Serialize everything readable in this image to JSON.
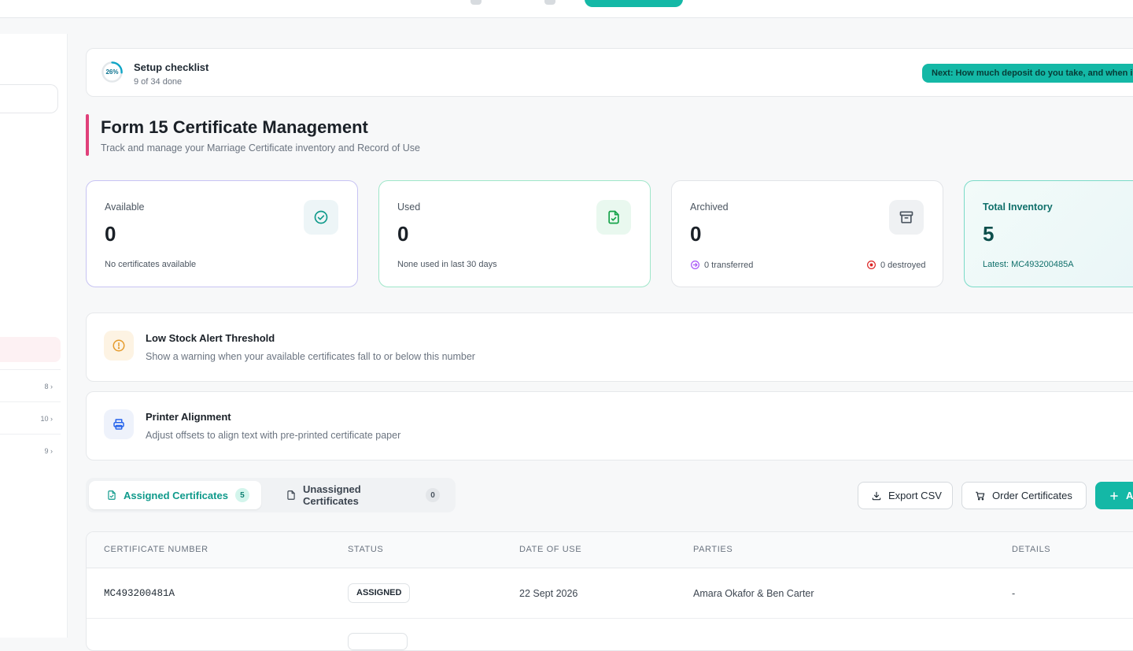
{
  "checklist": {
    "percent_label": "26%",
    "progress": 0.26,
    "title": "Setup checklist",
    "subtitle": "9 of 34 done",
    "next_label": "Next: How much deposit do you take, and when is"
  },
  "header": {
    "title": "Form 15 Certificate Management",
    "subtitle": "Track and manage your Marriage Certificate inventory and Record of Use"
  },
  "sidebar": {
    "counts": [
      "8 ›",
      "10 ›",
      "9 ›"
    ]
  },
  "stats": {
    "available": {
      "label": "Available",
      "value": "0",
      "note": "No certificates available"
    },
    "used": {
      "label": "Used",
      "value": "0",
      "note": "None used in last 30 days"
    },
    "archived": {
      "label": "Archived",
      "value": "0",
      "transferred": "0 transferred",
      "destroyed": "0 destroyed"
    },
    "total": {
      "label": "Total Inventory",
      "value": "5",
      "note": "Latest: MC493200485A"
    }
  },
  "settings": {
    "low_stock": {
      "title": "Low Stock Alert Threshold",
      "subtitle": "Show a warning when your available certificates fall to or below this number"
    },
    "printer": {
      "title": "Printer Alignment",
      "subtitle": "Adjust offsets to align text with pre-printed certificate paper"
    }
  },
  "tabs": {
    "assigned": {
      "label": "Assigned Certificates",
      "count": "5"
    },
    "unassigned": {
      "label": "Unassigned Certificates",
      "count": "0"
    }
  },
  "actions": {
    "export": "Export CSV",
    "order": "Order Certificates",
    "add": "A"
  },
  "table": {
    "headers": {
      "number": "CERTIFICATE NUMBER",
      "status": "STATUS",
      "date": "DATE OF USE",
      "parties": "PARTIES",
      "details": "DETAILS"
    },
    "rows": [
      {
        "number": "MC493200481A",
        "status": "ASSIGNED",
        "date": "22 Sept 2026",
        "parties": "Amara Okafor & Ben Carter",
        "details": "-"
      }
    ]
  },
  "colors": {
    "accent": "#14b8a6",
    "heading_bar": "#e0407a"
  }
}
